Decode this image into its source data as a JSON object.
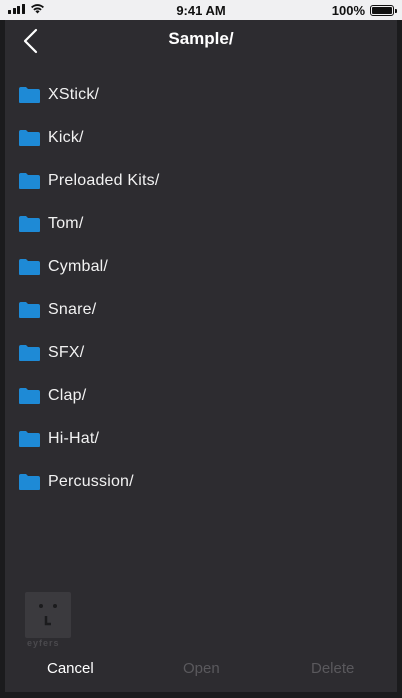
{
  "status_bar": {
    "time": "9:41 AM",
    "battery": "100%",
    "battery_level": 1.0,
    "icons": [
      "signal-icon",
      "wifi-icon",
      "battery-icon"
    ]
  },
  "header": {
    "title": "Sample/",
    "back_icon": "chevron-left-icon"
  },
  "folders": [
    {
      "label": "XStick/"
    },
    {
      "label": "Kick/"
    },
    {
      "label": "Preloaded Kits/"
    },
    {
      "label": "Tom/"
    },
    {
      "label": "Cymbal/"
    },
    {
      "label": "Snare/"
    },
    {
      "label": "SFX/"
    },
    {
      "label": "Clap/"
    },
    {
      "label": "Hi-Hat/"
    },
    {
      "label": "Percussion/"
    }
  ],
  "footer": {
    "cancel_label": "Cancel",
    "open_label": "Open",
    "delete_label": "Delete"
  },
  "colors": {
    "panel_bg": "#2d2c30",
    "folder_blue": "#1e8ad6",
    "text_primary": "#f2f2f2",
    "text_disabled": "#5a595d"
  }
}
